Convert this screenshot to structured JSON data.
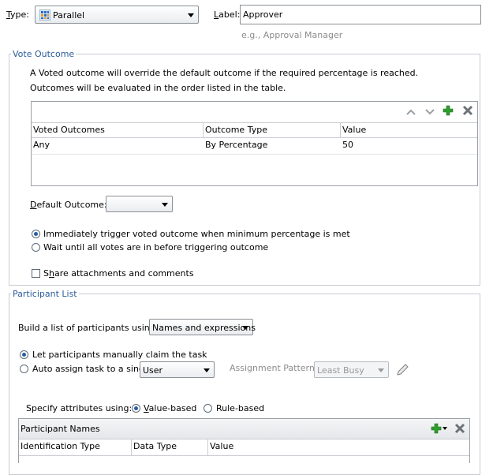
{
  "type": {
    "label_pre": "",
    "label_key": "T",
    "label_post": "ype:",
    "value": "Parallel",
    "icon": "parallel-grid-icon"
  },
  "label": {
    "label_pre": "",
    "label_key": "L",
    "label_post": "abel:",
    "value": "Approver",
    "hint": "e.g., Approval Manager"
  },
  "vote_outcome": {
    "legend": "Vote Outcome",
    "desc_line1": "A Voted outcome will override the default outcome if the required percentage is reached.",
    "desc_line2": "Outcomes will be evaluated in the order listed in the table.",
    "table": {
      "toolbar_icons": [
        "move-up-icon",
        "move-down-icon",
        "add-icon",
        "delete-icon"
      ],
      "columns": [
        "Voted Outcomes",
        "Outcome Type",
        "Value"
      ],
      "rows": [
        [
          "Any",
          "By Percentage",
          "50"
        ]
      ]
    },
    "default_outcome": {
      "label_pre": "",
      "label_key": "D",
      "label_post": "efault Outcome:",
      "value": ""
    },
    "radio_immediate": "Immediately trigger voted outcome when minimum percentage is met",
    "radio_wait": "Wait until all votes are in before triggering outcome",
    "share_pre": "S",
    "share_key": "h",
    "share_post": "are attachments and comments"
  },
  "participant_list": {
    "legend": "Participant List",
    "build_label": "Build a list of participants using:",
    "build_value": "Names and expressions",
    "radio_manual": "Let participants manually claim the task",
    "radio_auto": "Auto assign task to a single",
    "auto_value": "User",
    "assignment_label": "Assignment Pattern :",
    "assignment_value": "Least Busy",
    "specify_label": "Specify attributes using:",
    "value_based_key": "V",
    "value_based_rest": "alue-based",
    "rule_based": "Rule-based",
    "names_table": {
      "title": "Participant Names",
      "columns": [
        "Identification Type",
        "Data Type",
        "Value"
      ]
    }
  },
  "colors": {
    "accent": "#2a5c9a",
    "add_green": "#2e9e2e",
    "border": "#c7ccd1"
  }
}
